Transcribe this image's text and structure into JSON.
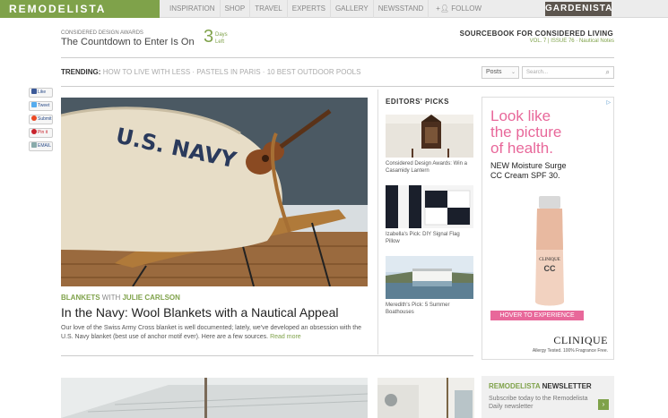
{
  "topbar": {
    "logo": "REMODELISTA",
    "nav": [
      "INSPIRATION",
      "SHOP",
      "TRAVEL",
      "EXPERTS",
      "GALLERY",
      "NEWSSTAND"
    ],
    "follow": "FOLLOW",
    "gardenista": "GARDENISTA"
  },
  "countdown": {
    "kicker": "Considered Design Awards",
    "title": "The Countdown to Enter Is On",
    "number": "3",
    "days_label": "Days Left"
  },
  "sourcebook": {
    "title": "SOURCEBOOK FOR CONSIDERED LIVING",
    "volume": "VOL. 7",
    "issue": "ISSUE 76",
    "theme": "Nautical Notes"
  },
  "trending": {
    "label": "TRENDING:",
    "items": [
      "HOW TO LIVE WITH LESS",
      "PASTELS IN PARIS",
      "10 BEST OUTDOOR POOLS"
    ]
  },
  "search": {
    "filter_value": "Posts",
    "placeholder": "Search..."
  },
  "share": [
    {
      "label": "Like"
    },
    {
      "label": "Tweet"
    },
    {
      "label": "Submit"
    },
    {
      "label": "Pin it"
    },
    {
      "label": "EMAIL"
    }
  ],
  "feature": {
    "category": "BLANKETS",
    "with_word": "WITH",
    "author": "JULIE CARLSON",
    "headline": "In the Navy: Wool Blankets with a Nautical Appeal",
    "excerpt": "Our love of the Swiss Army Cross blanket is well documented; lately, we've developed an obsession with the U.S. Navy blanket (best use of anchor motif ever). Here are a few sources.",
    "read_more": "Read more",
    "blanket_text": "U.S. NAVY"
  },
  "editors_picks": {
    "title": "EDITORS' PICKS",
    "items": [
      {
        "caption": "Considered Design Awards: Win a Casamidy Lantern"
      },
      {
        "caption": "Izabella's Pick: DIY Signal Flag Pillow"
      },
      {
        "caption": "Meredith's Pick: 5 Summer Boathouses"
      }
    ]
  },
  "ad": {
    "lines": [
      "Look like",
      "the picture",
      "of health."
    ],
    "product_line1": "NEW Moisture Surge",
    "product_line2": "CC Cream SPF 30.",
    "button": "HOVER TO EXPERIENCE",
    "brand": "CLINIQUE",
    "tagline": "Allergy Tested. 100% Fragrance Free.",
    "tube_brand": "CLINIQUE",
    "tube_text": "CC"
  },
  "newsletter": {
    "brand": "REMODELISTA",
    "title": "NEWSLETTER",
    "body": "Subscribe today to the Remodelista Daily newsletter"
  },
  "colors": {
    "brand_green": "#7fa24a",
    "ad_pink": "#e8689a",
    "gardenista_bg": "#5c554e"
  }
}
